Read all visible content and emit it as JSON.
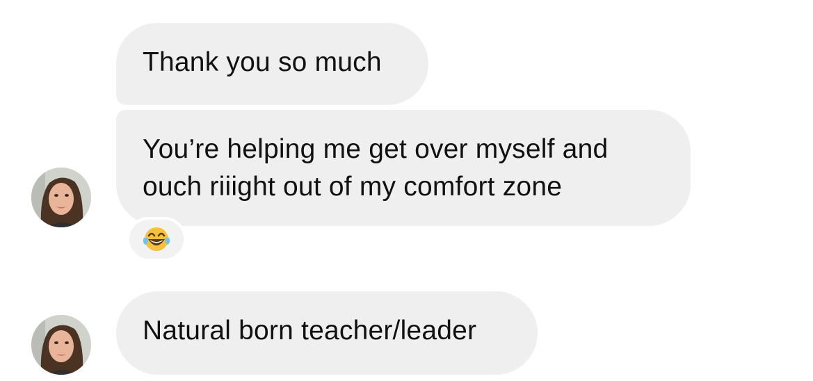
{
  "messages": [
    {
      "text": "Thank you so much",
      "sender": "self"
    },
    {
      "lines": [
        "You’re helping me get over myself and",
        "ouch riiight out of my comfort zone"
      ],
      "sender": "contact",
      "reaction": "tears-of-joy-emoji"
    },
    {
      "text": "Natural born teacher/leader",
      "sender": "contact"
    }
  ],
  "colors": {
    "bubble": "#efefef",
    "text": "#111111",
    "background": "#ffffff"
  },
  "icons": {
    "avatar": "contact-avatar-photo",
    "reaction": "face-with-tears-of-joy-icon"
  }
}
